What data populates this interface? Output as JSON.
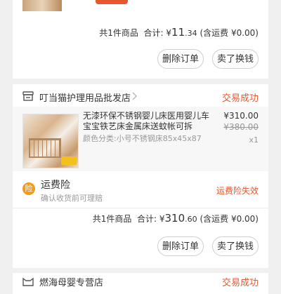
{
  "colors": {
    "accent": "#e5572e",
    "text": "#333333",
    "muted": "#999999",
    "bg": "#f0f0f0"
  },
  "order1": {
    "summary_count": "共1件商品",
    "summary_total_label": "合计: ¥",
    "summary_total_int": "11",
    "summary_total_dec": ".34",
    "summary_shipping": "(含运费 ¥0.00)",
    "delete_label": "删除订单",
    "sell_label": "卖了换钱"
  },
  "order2": {
    "shop_icon": "shop-icon",
    "shop_name": "叮当猫护理用品批发店",
    "status": "交易成功",
    "product": {
      "title": "无漆环保不锈钢婴儿床医用婴儿车宝宝铁艺床金属床送蚊帐可拆",
      "sku": "颜色分类:小号不锈钢床85x45x87",
      "price": "¥310.00",
      "orig_price": "¥380.00",
      "qty": "x1"
    },
    "insurance": {
      "icon_text": "险",
      "title": "运费险",
      "subtitle": "确认收货前可理赔",
      "status": "运费险失效"
    },
    "summary_count": "共1件商品",
    "summary_total_label": "合计: ¥",
    "summary_total_int": "310",
    "summary_total_dec": ".60",
    "summary_shipping": "(含运费 ¥0.00)",
    "delete_label": "删除订单",
    "sell_label": "卖了换钱"
  },
  "order3": {
    "shop_name": "燃海母婴专营店",
    "status": "交易成功"
  }
}
